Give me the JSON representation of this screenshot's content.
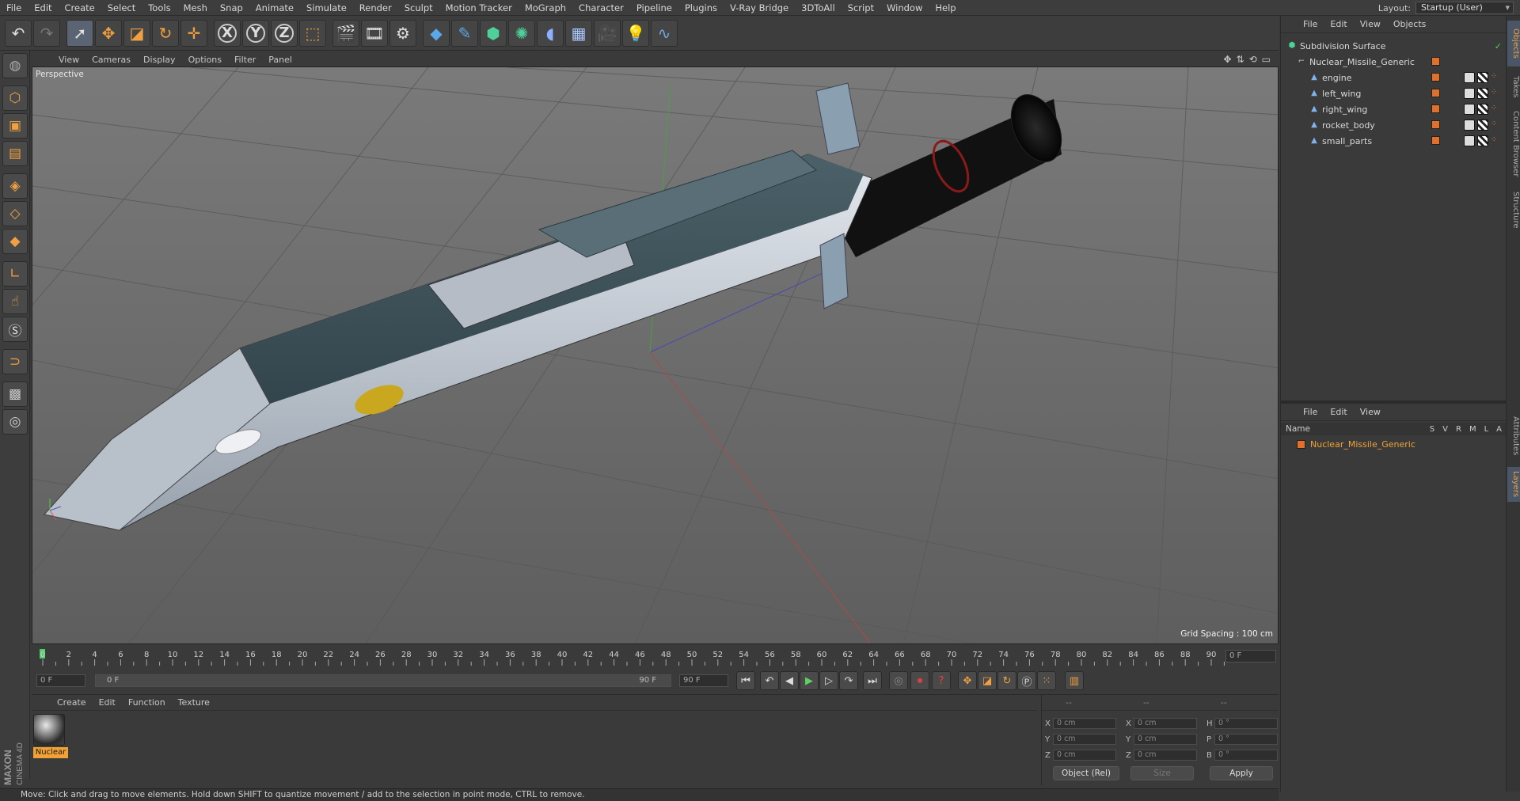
{
  "menubar": {
    "items": [
      "File",
      "Edit",
      "Create",
      "Select",
      "Tools",
      "Mesh",
      "Snap",
      "Animate",
      "Simulate",
      "Render",
      "Sculpt",
      "Motion Tracker",
      "MoGraph",
      "Character",
      "Pipeline",
      "Plugins",
      "V-Ray Bridge",
      "3DToAll",
      "Script",
      "Window",
      "Help"
    ],
    "layout_label": "Layout:",
    "layout_value": "Startup (User)"
  },
  "toolbar": {
    "icons": [
      "undo-icon",
      "redo-icon",
      "select-icon",
      "move-icon",
      "scale-icon",
      "rotate-icon",
      "transform-icon",
      "x-axis-icon",
      "y-axis-icon",
      "z-axis-icon",
      "coordinate-system-icon",
      "render-view-icon",
      "render-picture-viewer-icon",
      "edit-render-settings-icon",
      "cube-icon",
      "pen-icon",
      "subdivision-icon",
      "mograph-cloner-icon",
      "deformer-icon",
      "floor-icon",
      "camera-icon",
      "light-icon",
      "python-icon"
    ],
    "axis_x": "X",
    "axis_y": "Y",
    "axis_z": "Z"
  },
  "viewport": {
    "menu": [
      "View",
      "Cameras",
      "Display",
      "Options",
      "Filter",
      "Panel"
    ],
    "label": "Perspective",
    "grid_spacing": "Grid Spacing : 100 cm"
  },
  "timeline": {
    "ticks": [
      "0",
      "2",
      "4",
      "6",
      "8",
      "10",
      "12",
      "14",
      "16",
      "18",
      "20",
      "22",
      "24",
      "26",
      "28",
      "30",
      "32",
      "34",
      "36",
      "38",
      "40",
      "42",
      "44",
      "46",
      "48",
      "50",
      "52",
      "54",
      "56",
      "58",
      "60",
      "62",
      "64",
      "66",
      "68",
      "70",
      "72",
      "74",
      "76",
      "78",
      "80",
      "82",
      "84",
      "86",
      "88",
      "90"
    ],
    "current_frame": "0 F",
    "start_frame": "0 F",
    "range_start": "0 F",
    "range_end": "90 F",
    "end_frame": "90 F"
  },
  "material_manager": {
    "menu": [
      "Create",
      "Edit",
      "Function",
      "Texture"
    ],
    "material_name": "Nuclear"
  },
  "coordinates": {
    "header": [
      "--",
      "--",
      "--"
    ],
    "rows": [
      {
        "a1": "X",
        "v1": "0 cm",
        "a2": "X",
        "v2": "0 cm",
        "a3": "H",
        "v3": "0 °"
      },
      {
        "a1": "Y",
        "v1": "0 cm",
        "a2": "Y",
        "v2": "0 cm",
        "a3": "P",
        "v3": "0 °"
      },
      {
        "a1": "Z",
        "v1": "0 cm",
        "a2": "Z",
        "v2": "0 cm",
        "a3": "B",
        "v3": "0 °"
      }
    ],
    "mode": "Object (Rel)",
    "size_mode": "Size",
    "apply": "Apply"
  },
  "object_manager": {
    "menu": [
      "File",
      "Edit",
      "View",
      "Objects"
    ],
    "objects": [
      {
        "name": "Subdivision Surface",
        "level": 0
      },
      {
        "name": "Nuclear_Missile_Generic",
        "level": 1
      },
      {
        "name": "engine",
        "level": 2
      },
      {
        "name": "left_wing",
        "level": 2
      },
      {
        "name": "right_wing",
        "level": 2
      },
      {
        "name": "rocket_body",
        "level": 2
      },
      {
        "name": "small_parts",
        "level": 2
      }
    ]
  },
  "layer_manager": {
    "menu": [
      "File",
      "Edit",
      "View"
    ],
    "col_name": "Name",
    "cols": [
      "S",
      "V",
      "R",
      "M",
      "L",
      "A"
    ],
    "layer_name": "Nuclear_Missile_Generic"
  },
  "side_tabs": [
    "Objects",
    "Takes",
    "Content Browser",
    "Structure",
    "Attributes",
    "Layers"
  ],
  "status": "Move: Click and drag to move elements. Hold down SHIFT to quantize movement / add to the selection in point mode, CTRL to remove.",
  "brand": {
    "line1": "MAXON",
    "line2": "CINEMA 4D"
  },
  "colors": {
    "accent": "#f2a234",
    "viewport_bg": "#6b6b6b",
    "missile_dark": "#3f545c",
    "missile_light": "#c9cfd6"
  }
}
